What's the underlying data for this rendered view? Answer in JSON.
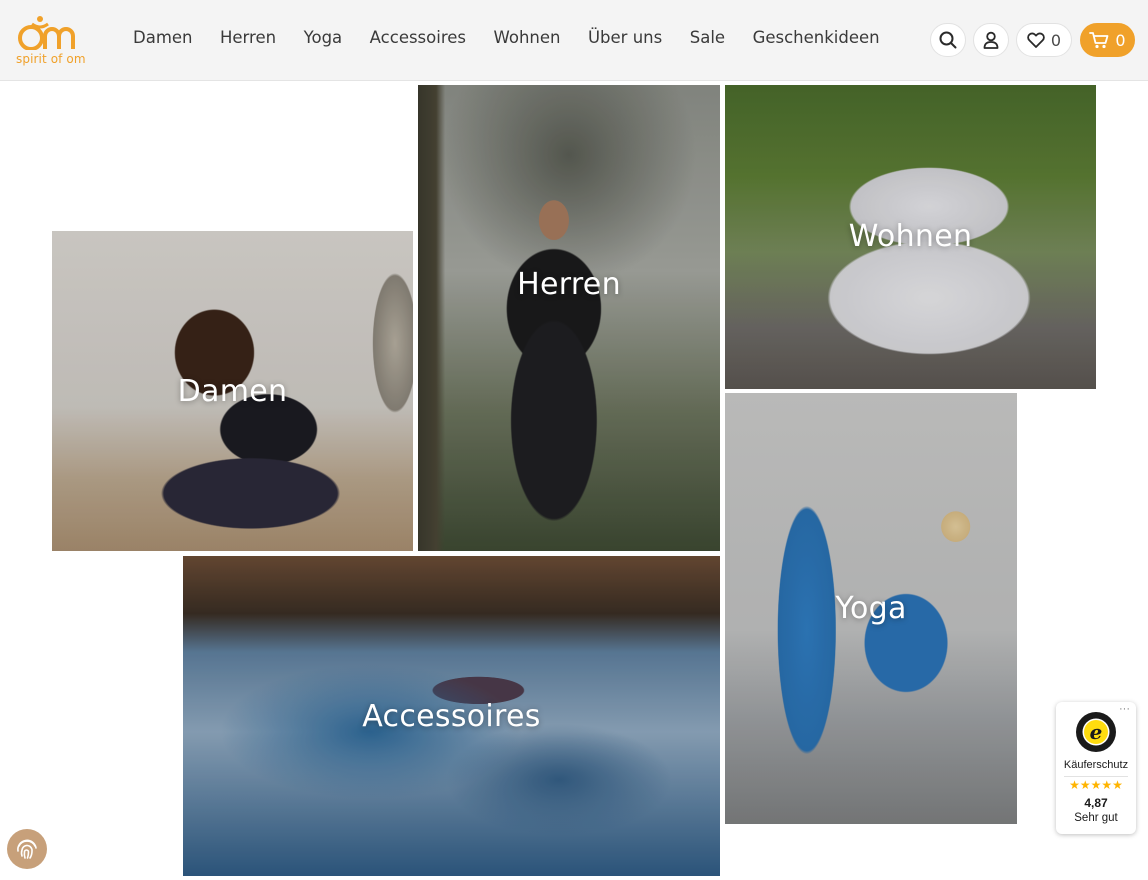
{
  "brand": {
    "logo_text": "spirit of om",
    "accent_color": "#f0a12a"
  },
  "nav": {
    "items": [
      "Damen",
      "Herren",
      "Yoga",
      "Accessoires",
      "Wohnen",
      "Über uns",
      "Sale",
      "Geschenkideen"
    ]
  },
  "header_actions": {
    "search_icon": "search-icon",
    "account_icon": "user-icon",
    "wishlist_icon": "heart-icon",
    "wishlist_count": "0",
    "cart_icon": "cart-icon",
    "cart_count": "0"
  },
  "tiles": {
    "damen": "Damen",
    "herren": "Herren",
    "wohnen": "Wohnen",
    "yoga": "Yoga",
    "accessoires": "Accessoires"
  },
  "trust_badge": {
    "label": "Käuferschutz",
    "stars": "★★★★★",
    "rating": "4,87",
    "verdict": "Sehr gut",
    "seal_letter": "e",
    "more": "···"
  },
  "cookie_button": {
    "icon": "fingerprint-icon"
  }
}
